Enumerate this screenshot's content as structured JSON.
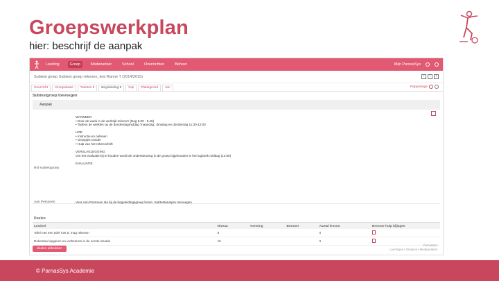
{
  "slide": {
    "title": "Groepswerkplan",
    "subtitle": "hier: beschrijf de aanpak",
    "copyright": "© ParnasSys Academie"
  },
  "navbar": {
    "items": [
      {
        "label": "Leerling",
        "active": false
      },
      {
        "label": "Groep",
        "active": true
      },
      {
        "label": "Medewerker",
        "active": false
      },
      {
        "label": "School",
        "active": false
      },
      {
        "label": "Overzichten",
        "active": false
      },
      {
        "label": "Beheer",
        "active": false
      }
    ],
    "right_label": "Mijn ParnasSys"
  },
  "subheader": {
    "title": "Subtest groep Subtest groep rekenen_test Ranne T (2014/2015)"
  },
  "tabs": {
    "items": [
      {
        "label": "Overzicht",
        "active": false
      },
      {
        "label": "Groepskaart",
        "active": false
      },
      {
        "label": "Toetsen ▾",
        "active": false
      },
      {
        "label": "Begeleiding ▾",
        "active": true
      },
      {
        "label": "Vop",
        "active": false
      },
      {
        "label": "Plattegrond",
        "active": false
      },
      {
        "label": "Jan",
        "active": false
      }
    ],
    "right_label": "Rapportage"
  },
  "section": {
    "title": "Subtestgroep toevoegen",
    "aanpak_label": "Aanpak"
  },
  "plan": {
    "lines": [
      "WANNEER",
      "• Door de week in de werktijd rekenen (Dag 8.00 - 9.45)",
      "• Tijdens de werkles op de donderdagmiddag 'maandag', dinsdag en donderdag 11:30-12:00",
      "",
      "HOE",
      "• Instructie en oefenen",
      "• Groepjes zonder",
      "• Hulp van het rekenschrift",
      "",
      "VERSLAGLEGGING",
      "Om het evaluatie bij te houden wordt de ondersteuning in de groep bijgehouden in het logboek middag (13:00)",
      "",
      "EVALUATIE"
    ],
    "rol_label": "Rol subtestgroep",
    "aan_label": "Aan Personen",
    "aan_text": "Voor Aan Personen die bij de begeleidingsgroep horen. Subtestanalyse toevoegen"
  },
  "doelen": {
    "title": "Doelen",
    "headers": [
      "Lesdoel",
      "Niveau",
      "Toetsing",
      "Bronner",
      "Aantal lesson",
      "Bronner hulp bijlagen"
    ],
    "rows": [
      [
        "Tafel met een tafel met 5, mag rekenen",
        "6",
        "",
        "",
        "0",
        "edit"
      ],
      [
        "Rekentaal opgaven en verbeteren in de eerste situatie",
        "10",
        "",
        "",
        "0",
        "doc"
      ]
    ]
  },
  "footer": {
    "button_label": "doelen afdrukken",
    "powered": "ParnasSys",
    "link": "Leerlingen • Groepen • Medewerkers"
  },
  "colors": {
    "accent": "#c8475d",
    "nav": "#e25a72"
  }
}
